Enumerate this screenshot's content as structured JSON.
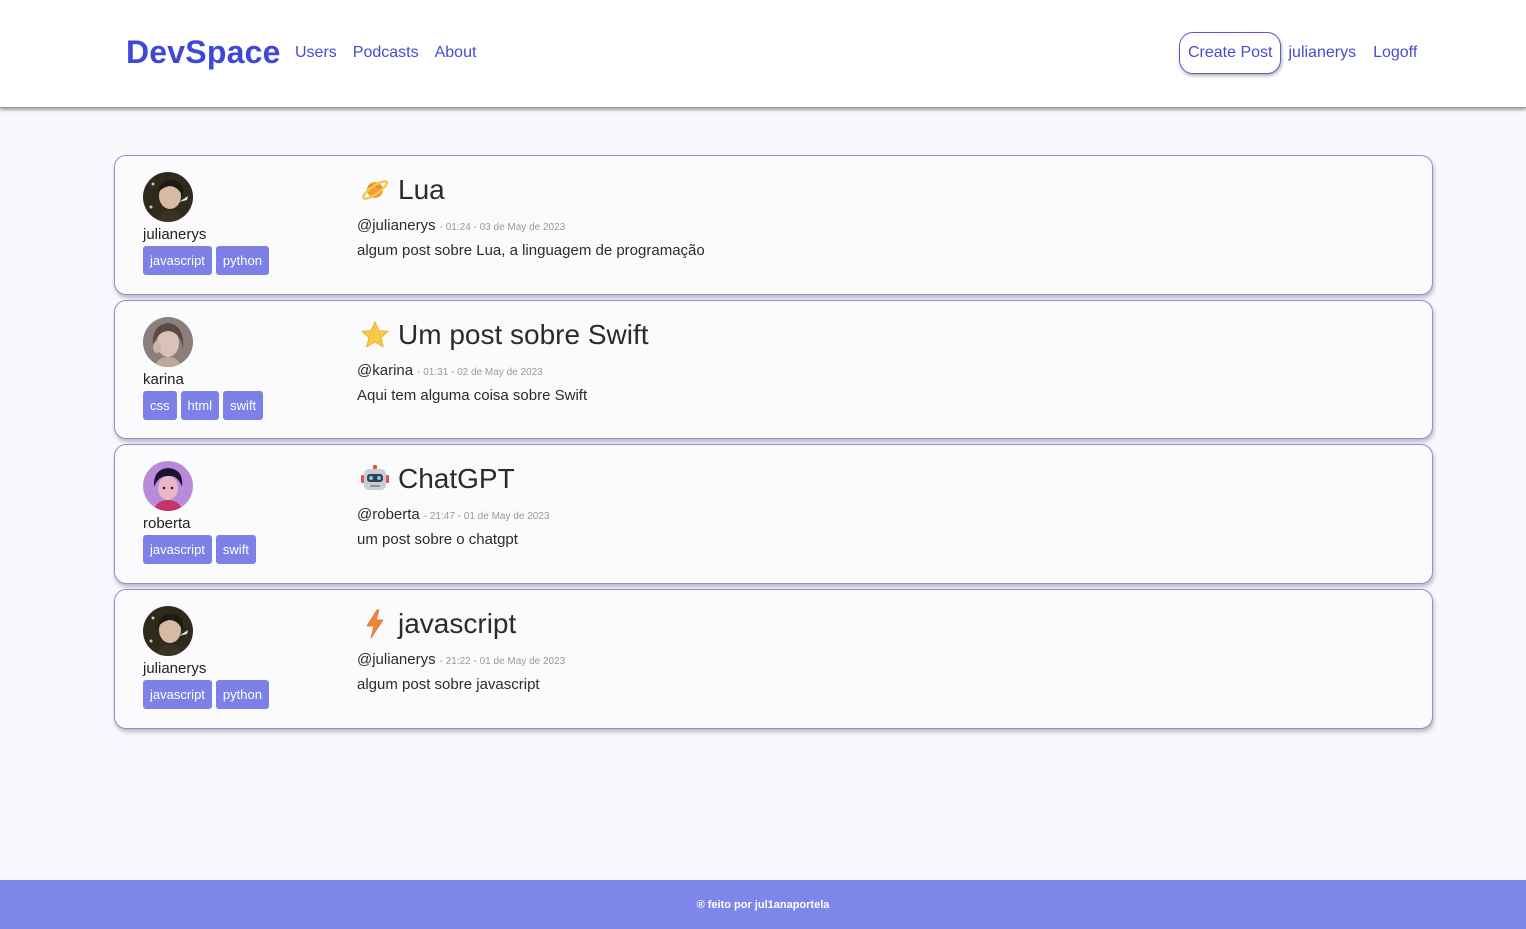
{
  "navbar": {
    "brand": "DevSpace",
    "links": [
      "Users",
      "Podcasts",
      "About"
    ],
    "create_post": "Create Post",
    "current_user": "julianerys",
    "logoff": "Logoff"
  },
  "posts": [
    {
      "author": "julianerys",
      "tags": [
        "javascript",
        "python"
      ],
      "emoji": "planet-icon",
      "title": "Lua",
      "handle": "@julianerys",
      "stamp": "- 01:24 - 03 de May de 2023",
      "body": "algum post sobre Lua, a linguagem de programação"
    },
    {
      "author": "karina",
      "tags": [
        "css",
        "html",
        "swift"
      ],
      "emoji": "star-icon",
      "title": "Um post sobre Swift",
      "handle": "@karina",
      "stamp": "- 01:31 - 02 de May de 2023",
      "body": "Aqui tem alguma coisa sobre Swift"
    },
    {
      "author": "roberta",
      "tags": [
        "javascript",
        "swift"
      ],
      "emoji": "robot-icon",
      "title": "ChatGPT",
      "handle": "@roberta",
      "stamp": "- 21:47 - 01 de May de 2023",
      "body": "um post sobre o chatgpt"
    },
    {
      "author": "julianerys",
      "tags": [
        "javascript",
        "python"
      ],
      "emoji": "lightning-icon",
      "title": "javascript",
      "handle": "@julianerys",
      "stamp": "- 21:22 - 01 de May de 2023",
      "body": "algum post sobre javascript"
    }
  ],
  "footer": {
    "text": "® feito por jul1anaportela"
  },
  "colors": {
    "brand": "#3f47d6",
    "tag_bg": "#7d80e6",
    "footer_bg": "#7e86ea",
    "card_border": "#8b8fe0"
  }
}
